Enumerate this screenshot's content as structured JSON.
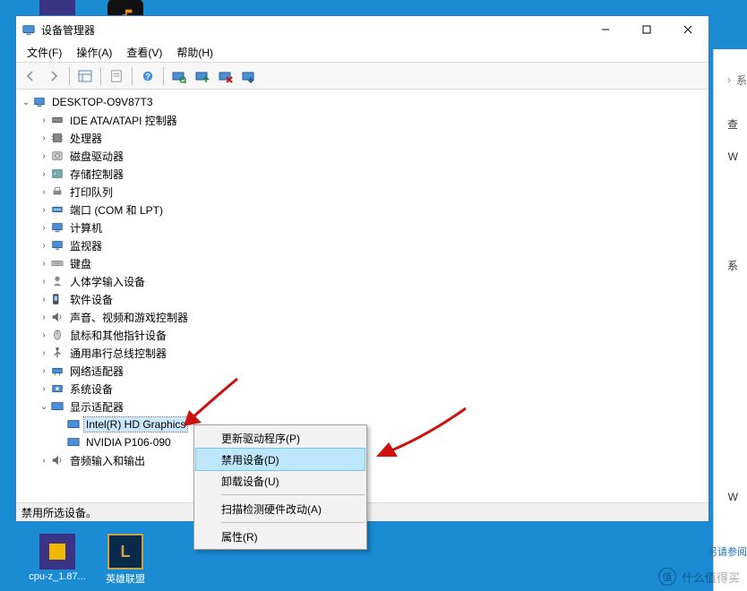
{
  "window": {
    "title": "设备管理器",
    "menus": {
      "file": "文件(F)",
      "action": "操作(A)",
      "view": "查看(V)",
      "help": "帮助(H)"
    },
    "statusbar": "禁用所选设备。"
  },
  "tree": {
    "root": "DESKTOP-O9V87T3",
    "categories": [
      {
        "label": "IDE ATA/ATAPI 控制器",
        "icon": "ide"
      },
      {
        "label": "处理器",
        "icon": "cpu"
      },
      {
        "label": "磁盘驱动器",
        "icon": "disk"
      },
      {
        "label": "存储控制器",
        "icon": "storage"
      },
      {
        "label": "打印队列",
        "icon": "printer"
      },
      {
        "label": "端口 (COM 和 LPT)",
        "icon": "port"
      },
      {
        "label": "计算机",
        "icon": "computer"
      },
      {
        "label": "监视器",
        "icon": "monitor"
      },
      {
        "label": "键盘",
        "icon": "keyboard"
      },
      {
        "label": "人体学输入设备",
        "icon": "hid"
      },
      {
        "label": "软件设备",
        "icon": "software"
      },
      {
        "label": "声音、视频和游戏控制器",
        "icon": "sound"
      },
      {
        "label": "鼠标和其他指针设备",
        "icon": "mouse"
      },
      {
        "label": "通用串行总线控制器",
        "icon": "usb"
      },
      {
        "label": "网络适配器",
        "icon": "network"
      },
      {
        "label": "系统设备",
        "icon": "system"
      }
    ],
    "display": {
      "label": "显示适配器",
      "children": [
        {
          "label": "Intel(R) HD Graphics",
          "selected": true
        },
        {
          "label": "NVIDIA P106-090"
        }
      ]
    },
    "audio": {
      "label": "音频输入和输出"
    }
  },
  "context_menu": {
    "update": "更新驱动程序(P)",
    "disable": "禁用设备(D)",
    "uninstall": "卸载设备(U)",
    "scan": "扫描检测硬件改动(A)",
    "properties": "属性(R)"
  },
  "side": {
    "breadcrumb": "系",
    "t1": "查",
    "t2": "W",
    "t3": "系",
    "t4": "W"
  },
  "desktop": {
    "cpuz": "cpu-z_1.87...",
    "lol": "英雄联盟"
  },
  "footer": {
    "watermark": "什么值得买",
    "watermark_badge": "值",
    "participate": "另请参阅"
  }
}
